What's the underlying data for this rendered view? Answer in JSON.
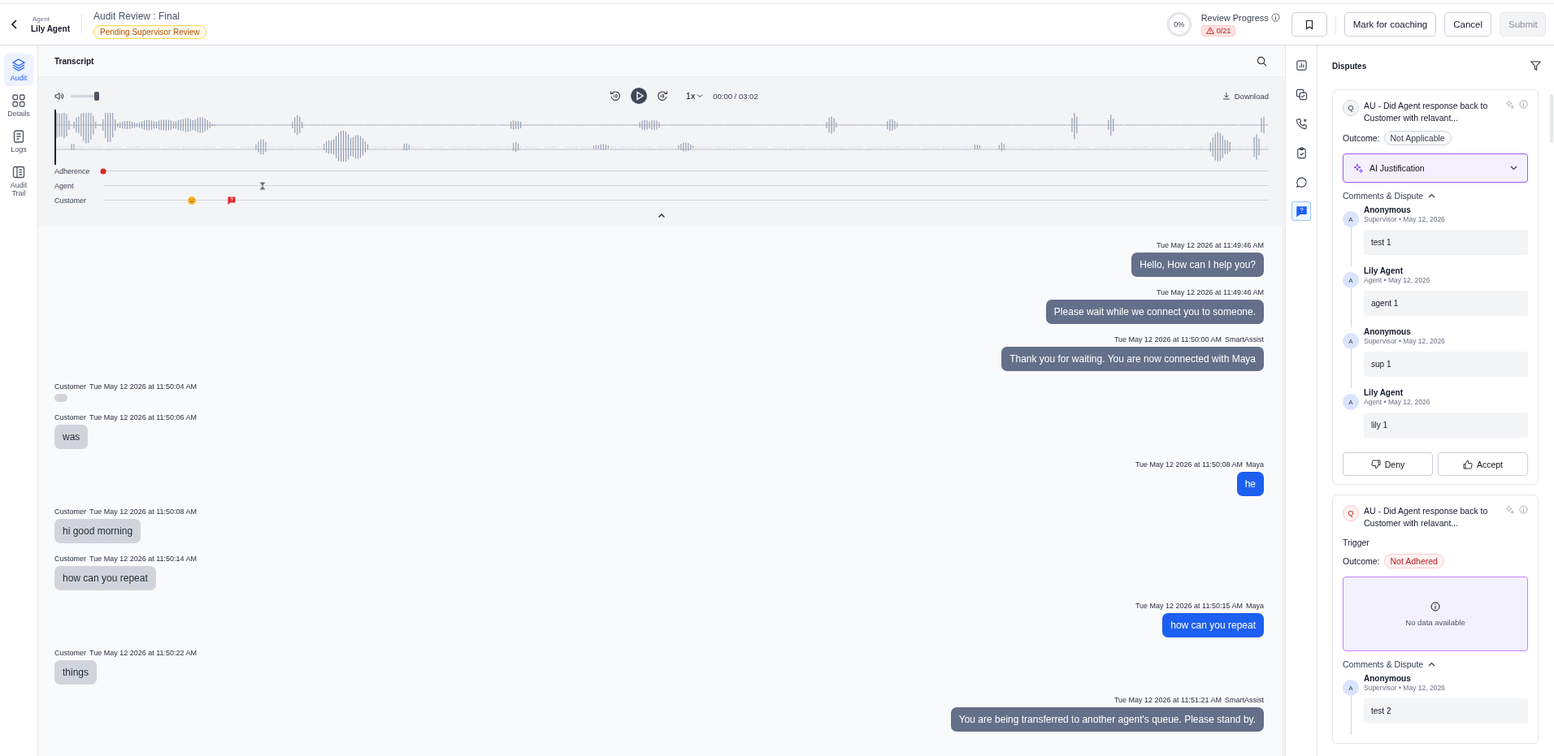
{
  "header": {
    "agent_label": "Agent",
    "agent_name": "Lily Agent",
    "title": "Audit Review : Final",
    "status_badge": "Pending Supervisor Review",
    "progress": {
      "ring_label": "0%",
      "level": 0,
      "label": "Review Progress",
      "warning": "0/21"
    },
    "buttons": [
      {
        "kind": "icon",
        "disabled": false
      },
      {
        "kind": "text",
        "label": "Mark for coaching",
        "disabled": false
      },
      {
        "kind": "text",
        "label": "Cancel",
        "disabled": false
      },
      {
        "kind": "text",
        "label": "Submit",
        "disabled": true
      }
    ]
  },
  "left_nav": [
    {
      "label": "Audit",
      "selected": true
    },
    {
      "label": "Details",
      "selected": false
    },
    {
      "label": "Logs",
      "selected": false
    },
    {
      "label": "Audit Trail",
      "selected": false
    }
  ],
  "transcript": {
    "title": "Transcript",
    "player": {
      "volume": {
        "level": 1
      },
      "speed": "1x",
      "time": "00:00 / 03:02",
      "download": "Download",
      "position": {
        "level": 0
      }
    },
    "tracks": [
      {
        "label": "Adherence"
      },
      {
        "label": "Agent"
      },
      {
        "label": "Customer"
      }
    ],
    "messages": [
      {
        "kind": "bot",
        "time": "Tue May 12 2026 at 11:49:46 AM",
        "text": "Hello, How can I help you?"
      },
      {
        "kind": "bot",
        "time": "Tue May 12 2026 at 11:49:46 AM",
        "text": "Please wait while we connect you to someone."
      },
      {
        "kind": "bot",
        "time": "Tue May 12 2026 at 11:50:00 AM",
        "speaker": "SmartAssist",
        "text": "Thank you for waiting. You are now connected with Maya"
      },
      {
        "kind": "customer",
        "speaker": "Customer",
        "time": "Tue May 12 2026 at 11:50:04 AM"
      },
      {
        "kind": "customer",
        "speaker": "Customer",
        "time": "Tue May 12 2026 at 11:50:06 AM",
        "text": "was"
      },
      {
        "kind": "agent",
        "time": "Tue May 12 2026 at 11:50:08 AM",
        "speaker": "Maya",
        "text": "he"
      },
      {
        "kind": "customer",
        "speaker": "Customer",
        "time": "Tue May 12 2026 at 11:50:08 AM",
        "text": "hi good morning"
      },
      {
        "kind": "customer",
        "speaker": "Customer",
        "time": "Tue May 12 2026 at 11:50:14 AM",
        "text": "how can you repeat"
      },
      {
        "kind": "agent",
        "time": "Tue May 12 2026 at 11:50:15 AM",
        "speaker": "Maya",
        "text": "how can you repeat"
      },
      {
        "kind": "customer",
        "speaker": "Customer",
        "time": "Tue May 12 2026 at 11:50:22 AM",
        "text": "things"
      },
      {
        "kind": "bot",
        "time": "Tue May 12 2026 at 11:51:21 AM",
        "speaker": "SmartAssist",
        "text": "You are being transferred to another agent's queue. Please stand by."
      }
    ]
  },
  "tool_rail": [
    {
      "selected": false
    },
    {
      "selected": false
    },
    {
      "selected": false
    },
    {
      "selected": false
    },
    {
      "selected": false
    },
    {
      "selected": true
    }
  ],
  "disputes": {
    "title": "Disputes",
    "cards": [
      {
        "kind": "neutral",
        "question_mark": "Q",
        "question": "AU - Did Agent response back to Customer with relavant...",
        "outcome_label": "Outcome:",
        "outcome": "Not Applicable",
        "justification": {
          "kind": "collapsed",
          "label": "AI Justification"
        },
        "comments_label": "Comments & Dispute",
        "comments_expanded": true,
        "comments": [
          {
            "avatar": "A",
            "author": "Anonymous",
            "meta": "Supervisor • May 12, 2026",
            "text": "test 1"
          },
          {
            "avatar": "A",
            "author": "Lily Agent",
            "meta": "Agent • May 12, 2026",
            "text": "agent 1"
          },
          {
            "avatar": "A",
            "author": "Anonymous",
            "meta": "Supervisor • May 12, 2026",
            "text": "sup 1"
          },
          {
            "avatar": "A",
            "author": "Lily Agent",
            "meta": "Agent • May 12, 2026",
            "text": "lily 1"
          }
        ],
        "actions": [
          {
            "kind": "deny",
            "label": "Deny"
          },
          {
            "kind": "accept",
            "label": "Accept"
          }
        ]
      },
      {
        "kind": "negative",
        "question_mark": "Q",
        "question": "AU - Did Agent response back to Customer with relavant...",
        "trigger": "Trigger",
        "outcome_label": "Outcome:",
        "outcome": "Not Adhered",
        "justification": {
          "kind": "empty",
          "message": "No data available"
        },
        "comments_label": "Comments & Dispute",
        "comments_expanded": true,
        "comments": [
          {
            "avatar": "A",
            "author": "Anonymous",
            "meta": "Supervisor • May 12, 2026",
            "text": "test 2"
          }
        ]
      }
    ]
  }
}
